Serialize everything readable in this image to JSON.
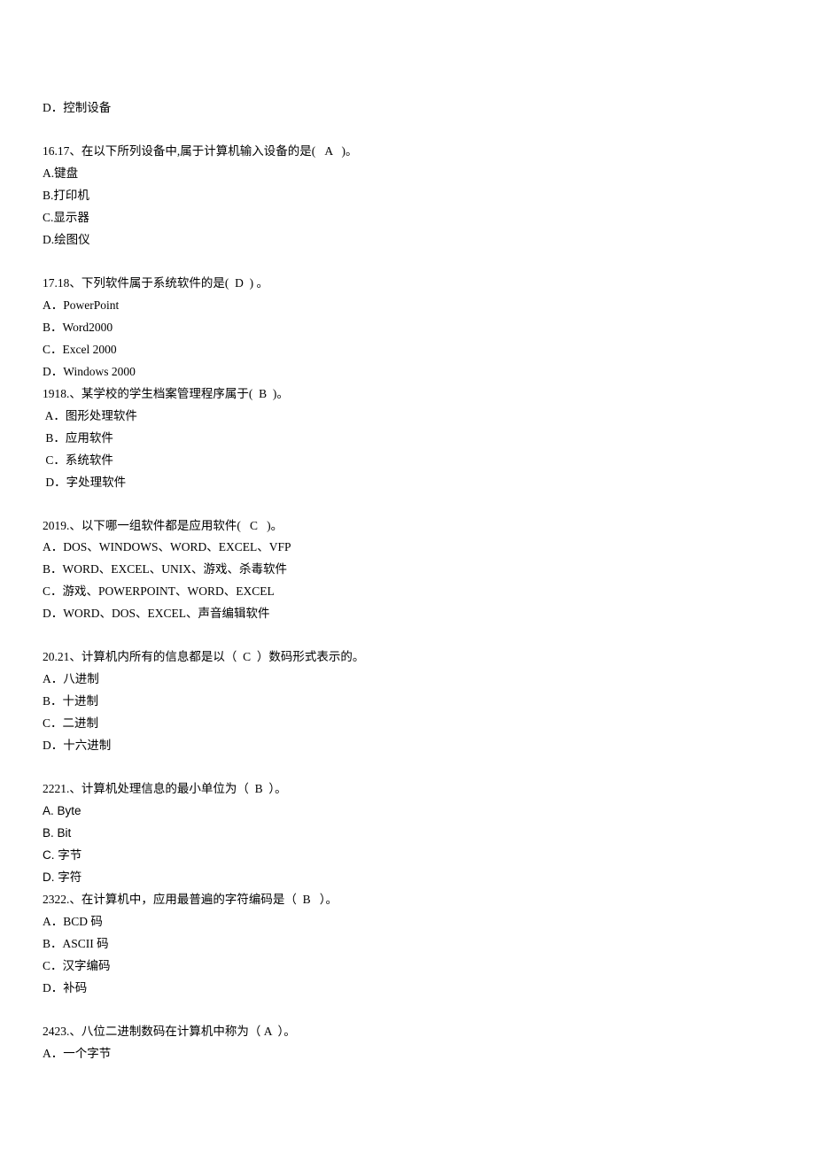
{
  "lines": {
    "l0": "D．控制设备",
    "l1": "16.17、在以下所列设备中,属于计算机输入设备的是(   A   )。",
    "l2": "A.键盘",
    "l3": "B.打印机",
    "l4": "C.显示器",
    "l5": "D.绘图仪",
    "l6": "17.18、下列软件属于系统软件的是(  D  ) 。",
    "l7": "A．PowerPoint",
    "l8": "B．Word2000",
    "l9": "C．Excel 2000",
    "l10": "D．Windows 2000",
    "l11": "1918.、某学校的学生档案管理程序属于(  B  )。",
    "l12": " A．图形处理软件",
    "l13": " B．应用软件",
    "l14": " C．系统软件",
    "l15": " D．字处理软件",
    "l16": "2019.、以下哪一组软件都是应用软件(   C   )。",
    "l17": "A．DOS、WINDOWS、WORD、EXCEL、VFP",
    "l18": "B．WORD、EXCEL、UNIX、游戏、杀毒软件",
    "l19": "C．游戏、POWERPOINT、WORD、EXCEL",
    "l20": "D．WORD、DOS、EXCEL、声音编辑软件",
    "l21": "20.21、计算机内所有的信息都是以（  C  ）数码形式表示的。",
    "l22": "A．八进制",
    "l23": "B．十进制",
    "l24": "C．二进制",
    "l25": "D．十六进制",
    "l26": "2221.、计算机处理信息的最小单位为（  B  ）。",
    "l27": "A. Byte",
    "l28": "B. Bit",
    "l29": "C. 字节",
    "l30": "D. 字符",
    "l31": "2322.、在计算机中，应用最普遍的字符编码是（  B   ）。",
    "l32": "A．BCD 码",
    "l33": "B．ASCII 码",
    "l34": "C．汉字编码",
    "l35": "D．补码",
    "l36": "2423.、八位二进制数码在计算机中称为（ A  ）。",
    "l37": "A．一个字节"
  }
}
